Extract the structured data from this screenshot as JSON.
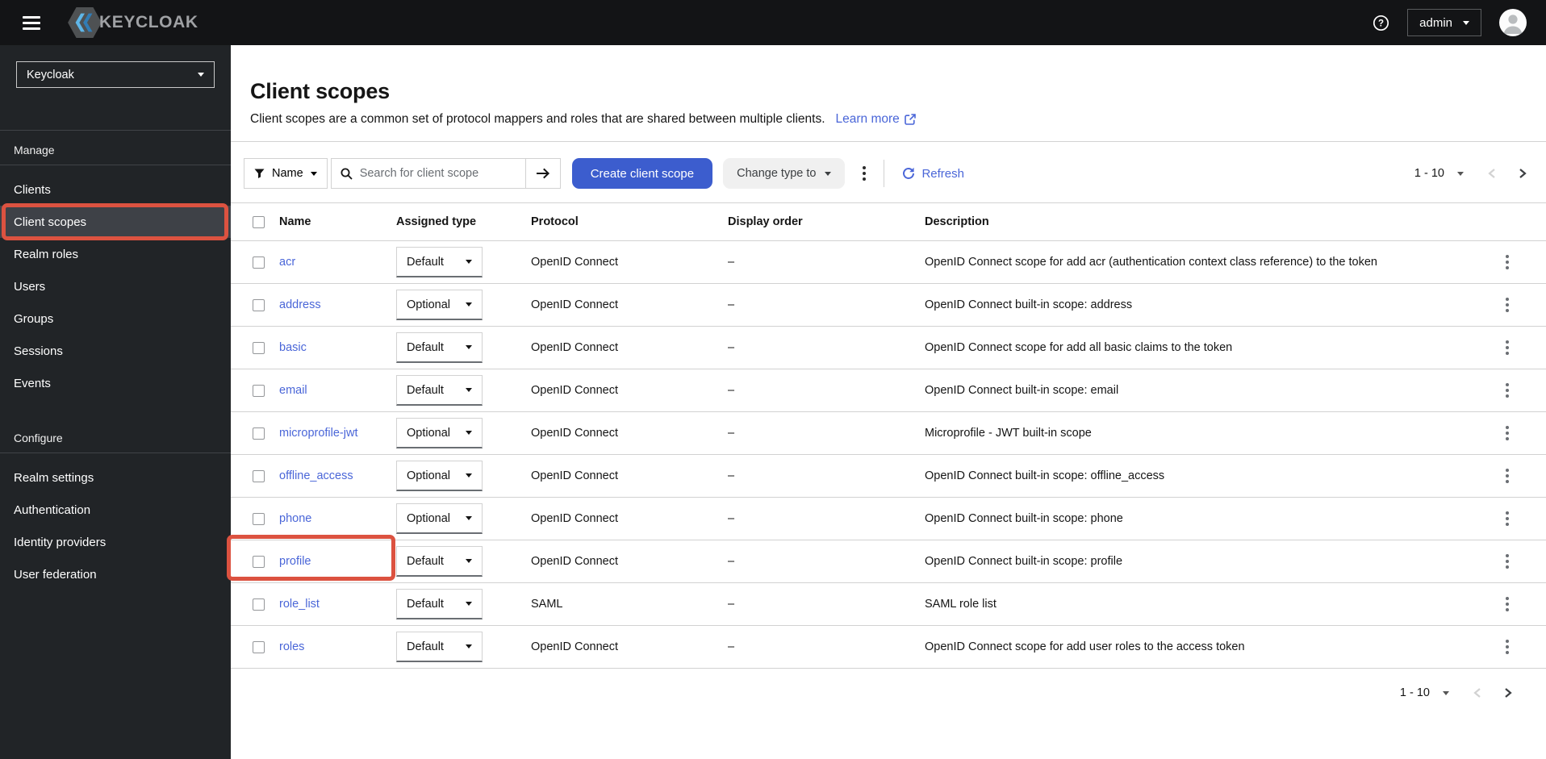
{
  "topbar": {
    "brand": "KEYCLOAK",
    "help_glyph": "?",
    "user_menu": {
      "label": "admin"
    }
  },
  "sidebar": {
    "realm_selector": "Keycloak",
    "sections": [
      {
        "label": "Manage",
        "items": [
          {
            "label": "Clients"
          },
          {
            "label": "Client scopes",
            "active": true
          },
          {
            "label": "Realm roles"
          },
          {
            "label": "Users"
          },
          {
            "label": "Groups"
          },
          {
            "label": "Sessions"
          },
          {
            "label": "Events"
          }
        ]
      },
      {
        "label": "Configure",
        "items": [
          {
            "label": "Realm settings"
          },
          {
            "label": "Authentication"
          },
          {
            "label": "Identity providers"
          },
          {
            "label": "User federation"
          }
        ]
      }
    ]
  },
  "page": {
    "title": "Client scopes",
    "description": "Client scopes are a common set of protocol mappers and roles that are shared between multiple clients.",
    "learn_more_label": "Learn more"
  },
  "toolbar": {
    "filter_label": "Name",
    "search_placeholder": "Search for client scope",
    "create_button_label": "Create client scope",
    "change_type_button_label": "Change type to",
    "refresh_label": "Refresh"
  },
  "pagination": {
    "range": "1 - 10"
  },
  "table": {
    "headers": [
      "Name",
      "Assigned type",
      "Protocol",
      "Display order",
      "Description"
    ],
    "rows": [
      {
        "name": "acr",
        "assigned_type": "Default",
        "protocol": "OpenID Connect",
        "display_order": "–",
        "description": "OpenID Connect scope for add acr (authentication context class reference) to the token"
      },
      {
        "name": "address",
        "assigned_type": "Optional",
        "protocol": "OpenID Connect",
        "display_order": "–",
        "description": "OpenID Connect built-in scope: address"
      },
      {
        "name": "basic",
        "assigned_type": "Default",
        "protocol": "OpenID Connect",
        "display_order": "–",
        "description": "OpenID Connect scope for add all basic claims to the token"
      },
      {
        "name": "email",
        "assigned_type": "Default",
        "protocol": "OpenID Connect",
        "display_order": "–",
        "description": "OpenID Connect built-in scope: email"
      },
      {
        "name": "microprofile-jwt",
        "assigned_type": "Optional",
        "protocol": "OpenID Connect",
        "display_order": "–",
        "description": "Microprofile - JWT built-in scope"
      },
      {
        "name": "offline_access",
        "assigned_type": "Optional",
        "protocol": "OpenID Connect",
        "display_order": "–",
        "description": "OpenID Connect built-in scope: offline_access"
      },
      {
        "name": "phone",
        "assigned_type": "Optional",
        "protocol": "OpenID Connect",
        "display_order": "–",
        "description": "OpenID Connect built-in scope: phone"
      },
      {
        "name": "profile",
        "assigned_type": "Default",
        "protocol": "OpenID Connect",
        "display_order": "–",
        "description": "OpenID Connect built-in scope: profile",
        "highlighted": true
      },
      {
        "name": "role_list",
        "assigned_type": "Default",
        "protocol": "SAML",
        "display_order": "–",
        "description": "SAML role list"
      },
      {
        "name": "roles",
        "assigned_type": "Default",
        "protocol": "OpenID Connect",
        "display_order": "–",
        "description": "OpenID Connect scope for add user roles to the access token"
      }
    ]
  },
  "annotations": {
    "color": "#dc5240",
    "targets": [
      "sidebar-client-scopes-item",
      "profile-row-name"
    ]
  },
  "colors": {
    "masthead_bg": "#131416",
    "sidebar_bg": "#212427",
    "primary_button": "#3c5dce",
    "link": "#4a66d8",
    "annotation": "#dc5240"
  }
}
